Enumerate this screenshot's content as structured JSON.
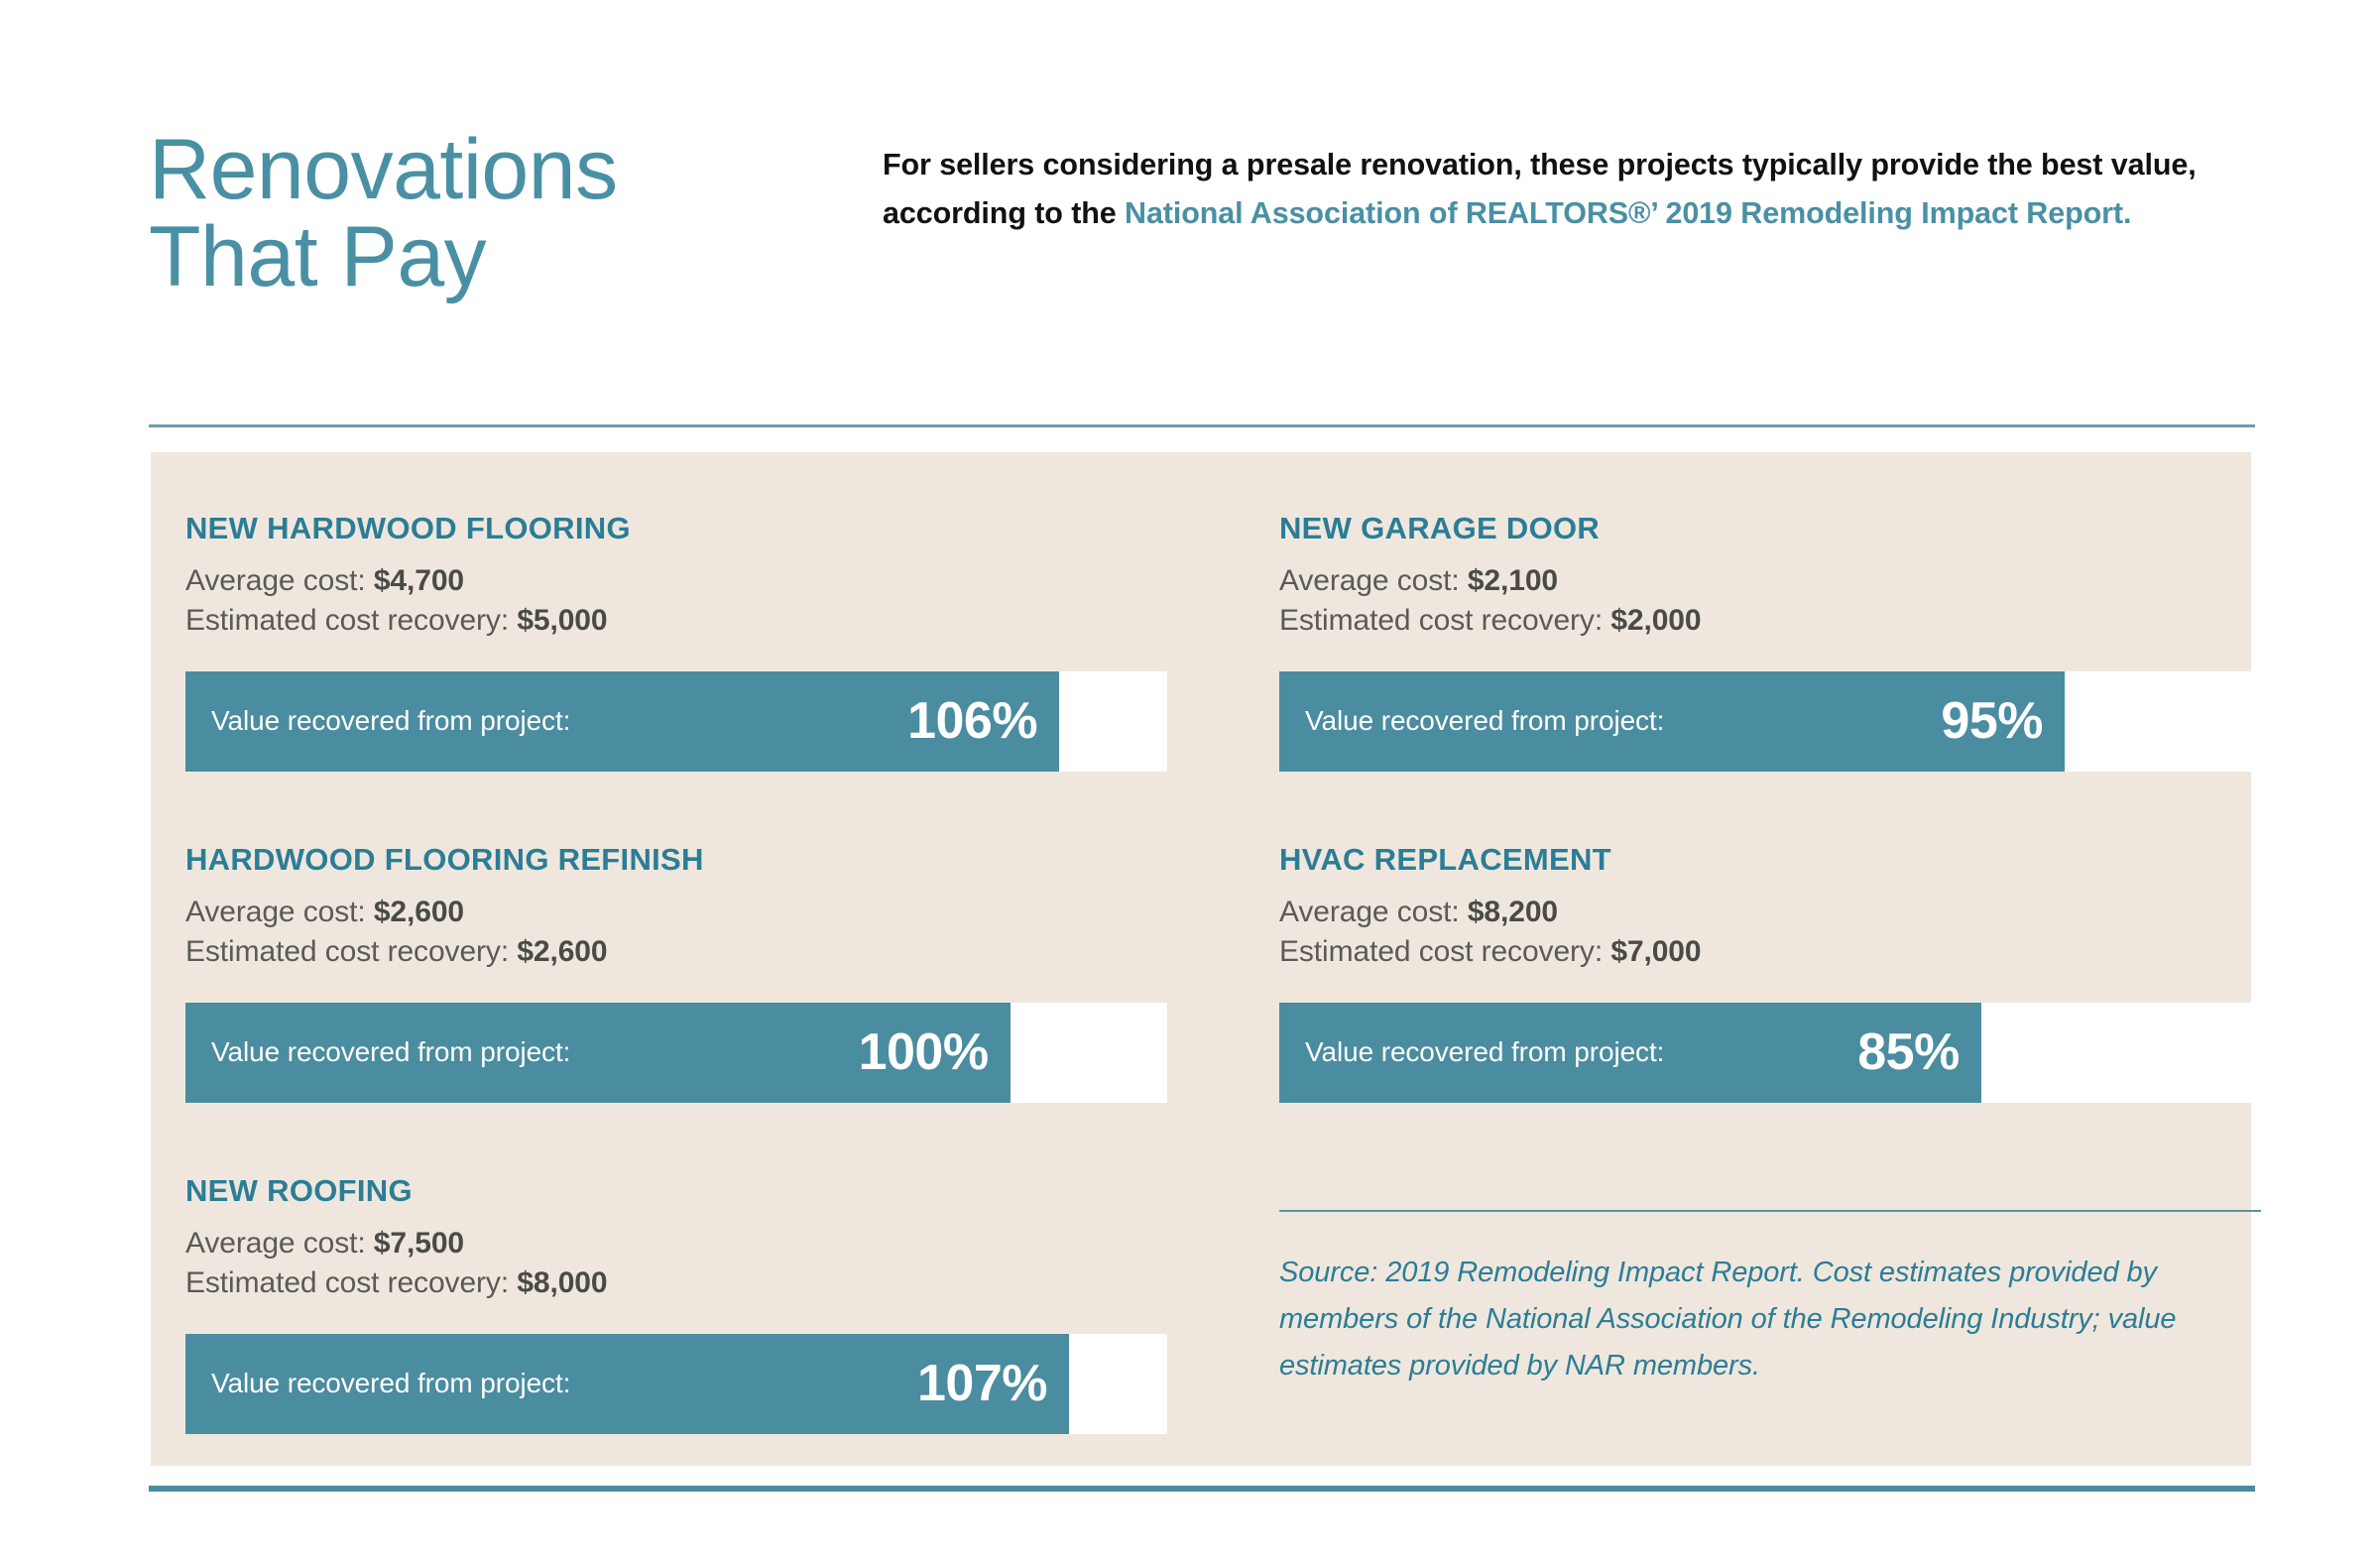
{
  "header": {
    "title": "Renovations\nThat Pay",
    "intro_part1": "For sellers considering a presale renovation, these projects typically provide the best value, according to the ",
    "intro_highlight": "National Association of REALTORS®’ 2019 Remodeling Impact Report."
  },
  "labels": {
    "average_cost": "Average cost:",
    "estimated_recovery": "Estimated cost recovery:",
    "value_recovered": "Value recovered from project:"
  },
  "colors": {
    "teal_heading": "#2b7d96",
    "teal_bar": "#4a8ca0",
    "teal_title": "#4a90a4",
    "panel_bg": "#efe7dd",
    "body_text": "#5a5a57",
    "track_bg": "#ffffff"
  },
  "source": {
    "text": "Source: 2019 Remodeling Impact Report. Cost estimates provided by members of the National Association of the Remodeling Industry; value estimates provided by NAR members."
  },
  "chart_data": {
    "type": "bar",
    "title": "Renovations That Pay",
    "xlabel": "",
    "ylabel": "Value recovered from project (%)",
    "xlim": [
      0,
      107
    ],
    "categories": [
      "New Hardwood Flooring",
      "Hardwood Flooring Refinish",
      "New Roofing",
      "New Garage Door",
      "HVAC Replacement"
    ],
    "values": [
      106,
      100,
      107,
      95,
      85
    ],
    "value_labels": [
      "106%",
      "100%",
      "107%",
      "95%",
      "85%"
    ],
    "average_cost": [
      4700,
      2600,
      7500,
      2100,
      8200
    ],
    "estimated_cost_recovery": [
      5000,
      2600,
      8000,
      2000,
      7000
    ],
    "grid": false,
    "legend": "none"
  },
  "cards_left": [
    {
      "title": "NEW HARDWOOD FLOORING",
      "cost": "$4,700",
      "recovery": "$5,000",
      "percent_label": "106%",
      "fill_width": "89%"
    },
    {
      "title": "HARDWOOD FLOORING REFINISH",
      "cost": "$2,600",
      "recovery": "$2,600",
      "percent_label": "100%",
      "fill_width": "84%"
    },
    {
      "title": "NEW ROOFING",
      "cost": "$7,500",
      "recovery": "$8,000",
      "percent_label": "107%",
      "fill_width": "90%"
    }
  ],
  "cards_right": [
    {
      "title": "NEW GARAGE DOOR",
      "cost": "$2,100",
      "recovery": "$2,000",
      "percent_label": "95%",
      "fill_width": "80%"
    },
    {
      "title": "HVAC REPLACEMENT",
      "cost": "$8,200",
      "recovery": "$7,000",
      "percent_label": "85%",
      "fill_width": "71.5%"
    }
  ]
}
